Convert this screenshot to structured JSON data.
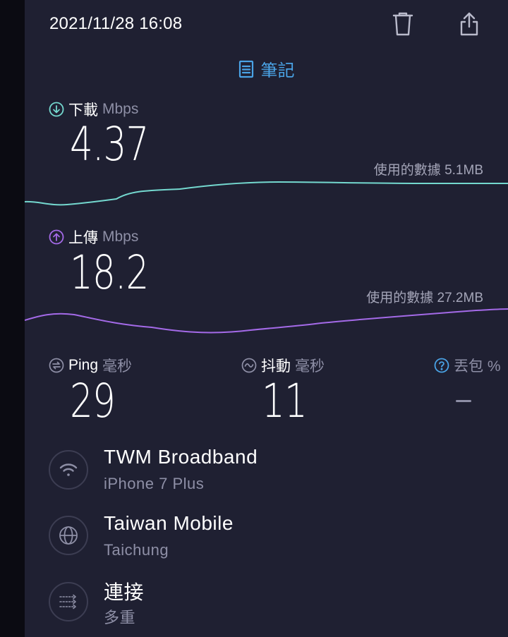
{
  "header": {
    "datetime": "2021/11/28 16:08",
    "delete_icon": "trash-icon",
    "share_icon": "share-icon",
    "notes_label": "筆記"
  },
  "download": {
    "label": "下載",
    "unit": "Mbps",
    "value": "4.37",
    "data_used": "使用的數據 5.1MB",
    "color": "#74d8cf"
  },
  "upload": {
    "label": "上傳",
    "unit": "Mbps",
    "value": "18.2",
    "data_used": "使用的數據 27.2MB",
    "color": "#a46ae8"
  },
  "stats": {
    "ping_label": "Ping",
    "ping_unit": "毫秒",
    "ping_value": "29",
    "jitter_label": "抖動",
    "jitter_unit": "毫秒",
    "jitter_value": "11",
    "loss_label": "丟包 %",
    "loss_value": ""
  },
  "info": [
    {
      "title": "TWM Broadband",
      "subtitle": "iPhone 7 Plus",
      "icon": "wifi-icon"
    },
    {
      "title": "Taiwan Mobile",
      "subtitle": "Taichung",
      "icon": "globe-icon"
    },
    {
      "title": "連接",
      "subtitle": "多重",
      "icon": "connections-icon"
    }
  ],
  "colors": {
    "background": "#1f2032",
    "accent_blue": "#4aa3e6",
    "muted": "#8e8fa6"
  }
}
